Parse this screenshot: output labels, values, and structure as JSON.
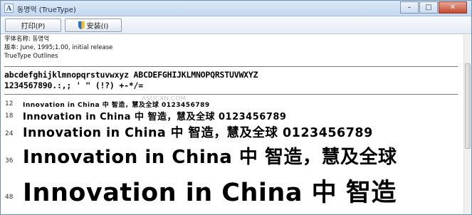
{
  "window": {
    "title": "동명억 (TrueType)",
    "app_icon": "A",
    "controls": {
      "minimize": "–",
      "maximize": "□",
      "close": "✕"
    }
  },
  "toolbar": {
    "print_label": "打印(P)",
    "install_label": "安装(I)"
  },
  "font_info": {
    "name_line": "字体名称: 동명억",
    "version_line": "版本: June, 1995;1.00, initial release",
    "type_line": "TrueType Outlines"
  },
  "charset": {
    "line1": "abcdefghijklmnopqrstuvwxyz ABCDEFGHIJKLMNOPQRSTUVWXYZ",
    "line2": "1234567890.:,; ' \" (!?) +-*/="
  },
  "samples": [
    {
      "size": "12",
      "text": "Innovation in China 中  智造，慧及全球 0123456789"
    },
    {
      "size": "18",
      "text": "Innovation in China 中  智造，慧及全球 0123456789"
    },
    {
      "size": "24",
      "text": "Innovation in China 中  智造，慧及全球 0123456789"
    },
    {
      "size": "36",
      "text": "Innovation in China 中  智造，慧及全球"
    },
    {
      "size": "48",
      "text": "Innovation in China 中  智造"
    }
  ],
  "watermark": "ASOCXN.COM"
}
